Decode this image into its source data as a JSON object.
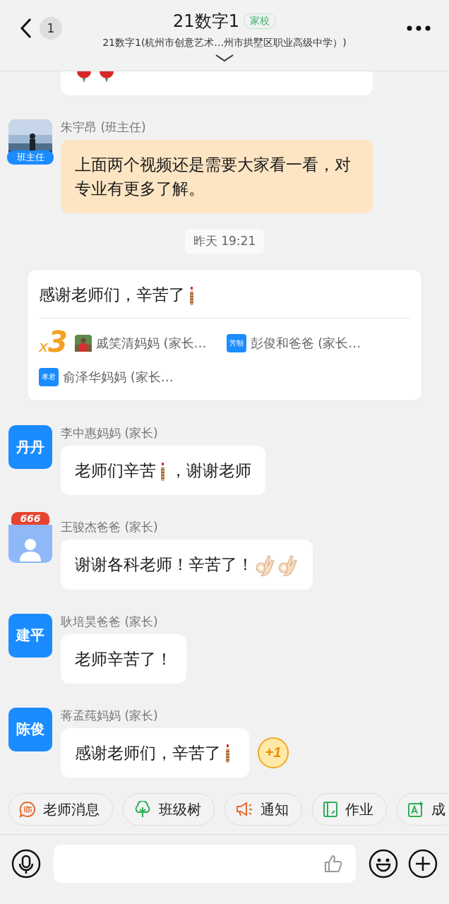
{
  "header": {
    "back_count": "1",
    "title": "21数字1",
    "tag": "家校",
    "subtitle": "21数字1(杭州市创意艺术…州市拱墅区职业高级中学）)"
  },
  "messages": [
    {
      "kind": "cut_bubble"
    },
    {
      "kind": "message",
      "sender": "朱宇昂 (班主任)",
      "avatar": {
        "badge": "班主任"
      },
      "highlight": true,
      "parts": [
        {
          "kind": "text",
          "text": "上面两个视频还是需要大家看一看，对专业有更多了解。"
        }
      ]
    },
    {
      "kind": "time",
      "text": "昨天 19:21"
    },
    {
      "kind": "relay",
      "parts": [
        {
          "kind": "text",
          "text": "感谢老师们，辛苦了"
        },
        {
          "kind": "firecracker"
        }
      ],
      "times_sign": "x",
      "count": "3",
      "participants": [
        {
          "name": "戚笑清妈妈 (家长…"
        },
        {
          "name": "彭俊和爸爸 (家长…",
          "avatar": {
            "kind": "initials",
            "text": "芳朝"
          }
        },
        {
          "name": "俞泽华妈妈 (家长…",
          "avatar": {
            "kind": "initials",
            "text": "孝君"
          }
        }
      ]
    },
    {
      "kind": "message",
      "sender": "李中惠妈妈 (家长)",
      "avatar": {
        "kind": "initials",
        "text": "丹丹"
      },
      "highlight": false,
      "parts": [
        {
          "kind": "text",
          "text": "老师们辛苦"
        },
        {
          "kind": "firecracker"
        },
        {
          "kind": "text",
          "text": "，谢谢老师"
        }
      ]
    },
    {
      "kind": "message",
      "sender": "王骏杰爸爸 (家长)",
      "avatar": {
        "kind": "default",
        "badge": "666"
      },
      "highlight": false,
      "parts": [
        {
          "kind": "text",
          "text": "谢谢各科老师！辛苦了！"
        },
        {
          "kind": "ok_hand"
        },
        {
          "kind": "ok_hand"
        }
      ]
    },
    {
      "kind": "message",
      "sender": "耿培昊爸爸 (家长)",
      "avatar": {
        "kind": "initials",
        "text": "建平"
      },
      "highlight": false,
      "parts": [
        {
          "kind": "text",
          "text": "老师辛苦了！"
        }
      ]
    },
    {
      "kind": "message",
      "sender": "蒋孟莼妈妈 (家长)",
      "avatar": {
        "kind": "initials",
        "text": "陈俊"
      },
      "highlight": false,
      "plus_one": "+1",
      "parts": [
        {
          "kind": "text",
          "text": "感谢老师们，辛苦了"
        },
        {
          "kind": "firecracker"
        }
      ]
    }
  ],
  "shortcuts": [
    {
      "label": "老师消息"
    },
    {
      "label": "班级树"
    },
    {
      "label": "通知"
    },
    {
      "label": "作业"
    },
    {
      "label": "成"
    }
  ]
}
